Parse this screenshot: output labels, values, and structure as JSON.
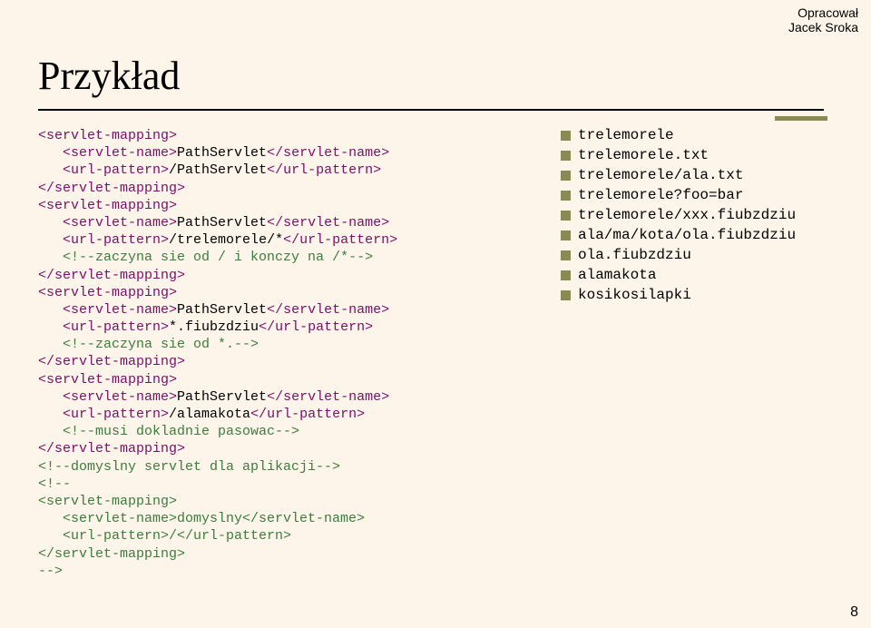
{
  "attribution": {
    "line1": "Opracował",
    "line2": "Jacek Sroka"
  },
  "title": "Przykład",
  "code_lines": [
    [
      {
        "c": "k",
        "t": "<servlet-mapping>"
      }
    ],
    [
      {
        "c": "t",
        "t": "   "
      },
      {
        "c": "k",
        "t": "<servlet-name>"
      },
      {
        "c": "t",
        "t": "PathServlet"
      },
      {
        "c": "k",
        "t": "</servlet-name>"
      }
    ],
    [
      {
        "c": "t",
        "t": "   "
      },
      {
        "c": "k",
        "t": "<url-pattern>"
      },
      {
        "c": "t",
        "t": "/PathServlet"
      },
      {
        "c": "k",
        "t": "</url-pattern>"
      }
    ],
    [
      {
        "c": "k",
        "t": "</servlet-mapping>"
      }
    ],
    [
      {
        "c": "k",
        "t": "<servlet-mapping>"
      }
    ],
    [
      {
        "c": "t",
        "t": "   "
      },
      {
        "c": "k",
        "t": "<servlet-name>"
      },
      {
        "c": "t",
        "t": "PathServlet"
      },
      {
        "c": "k",
        "t": "</servlet-name>"
      }
    ],
    [
      {
        "c": "t",
        "t": "   "
      },
      {
        "c": "k",
        "t": "<url-pattern>"
      },
      {
        "c": "t",
        "t": "/trelemorele/*"
      },
      {
        "c": "k",
        "t": "</url-pattern>"
      }
    ],
    [
      {
        "c": "t",
        "t": "   "
      },
      {
        "c": "c",
        "t": "<!--zaczyna sie od / i konczy na /*-->"
      }
    ],
    [
      {
        "c": "k",
        "t": "</servlet-mapping>"
      }
    ],
    [
      {
        "c": "k",
        "t": "<servlet-mapping>"
      }
    ],
    [
      {
        "c": "t",
        "t": "   "
      },
      {
        "c": "k",
        "t": "<servlet-name>"
      },
      {
        "c": "t",
        "t": "PathServlet"
      },
      {
        "c": "k",
        "t": "</servlet-name>"
      }
    ],
    [
      {
        "c": "t",
        "t": "   "
      },
      {
        "c": "k",
        "t": "<url-pattern>"
      },
      {
        "c": "t",
        "t": "*.fiubzdziu"
      },
      {
        "c": "k",
        "t": "</url-pattern>"
      }
    ],
    [
      {
        "c": "t",
        "t": "   "
      },
      {
        "c": "c",
        "t": "<!--zaczyna sie od *.-->"
      }
    ],
    [
      {
        "c": "k",
        "t": "</servlet-mapping>"
      }
    ],
    [
      {
        "c": "k",
        "t": "<servlet-mapping>"
      }
    ],
    [
      {
        "c": "t",
        "t": "   "
      },
      {
        "c": "k",
        "t": "<servlet-name>"
      },
      {
        "c": "t",
        "t": "PathServlet"
      },
      {
        "c": "k",
        "t": "</servlet-name>"
      }
    ],
    [
      {
        "c": "t",
        "t": "   "
      },
      {
        "c": "k",
        "t": "<url-pattern>"
      },
      {
        "c": "t",
        "t": "/alamakota"
      },
      {
        "c": "k",
        "t": "</url-pattern>"
      }
    ],
    [
      {
        "c": "t",
        "t": "   "
      },
      {
        "c": "c",
        "t": "<!--musi dokladnie pasowac-->"
      }
    ],
    [
      {
        "c": "k",
        "t": "</servlet-mapping>"
      }
    ],
    [
      {
        "c": "c",
        "t": "<!--domyslny servlet dla aplikacji-->"
      }
    ],
    [
      {
        "c": "c",
        "t": "<!--"
      }
    ],
    [
      {
        "c": "c",
        "t": "<servlet-mapping>"
      }
    ],
    [
      {
        "c": "c",
        "t": "   <servlet-name>domyslny</servlet-name>"
      }
    ],
    [
      {
        "c": "c",
        "t": "   <url-pattern>/</url-pattern>"
      }
    ],
    [
      {
        "c": "c",
        "t": "</servlet-mapping>"
      }
    ],
    [
      {
        "c": "c",
        "t": "-->"
      }
    ]
  ],
  "list_items": [
    "trelemorele",
    "trelemorele.txt",
    "trelemorele/ala.txt",
    "trelemorele?foo=bar",
    "trelemorele/xxx.fiubzdziu",
    "ala/ma/kota/ola.fiubzdziu",
    "ola.fiubzdziu",
    "alamakota",
    "kosikosilapki"
  ],
  "page_number": "8"
}
